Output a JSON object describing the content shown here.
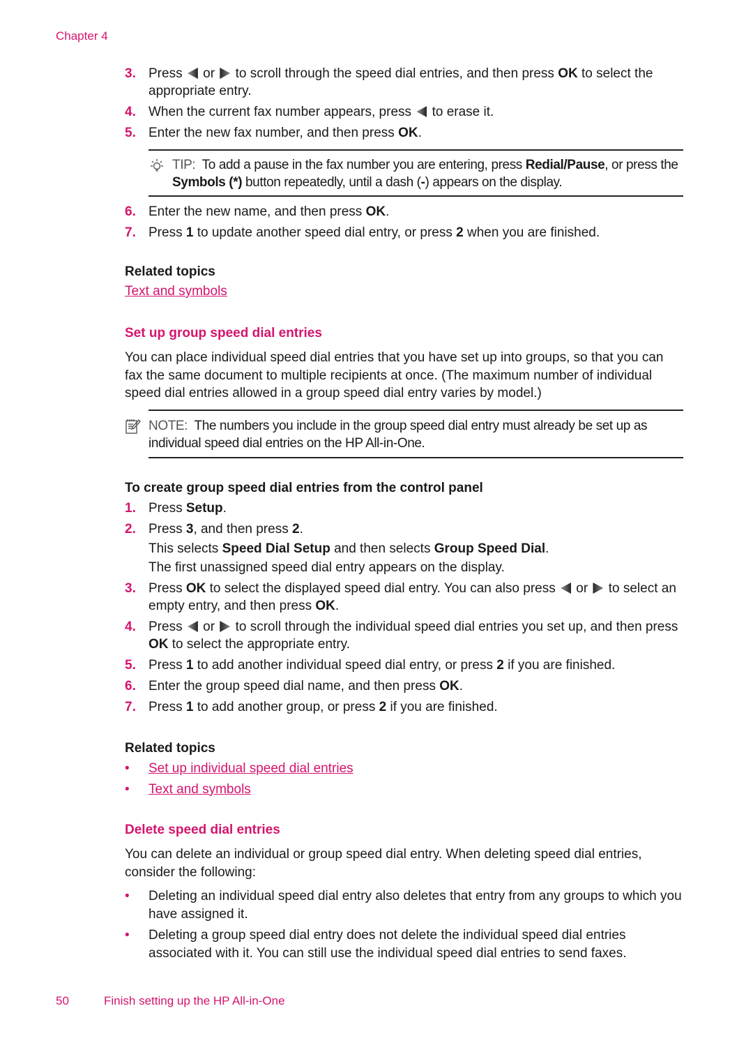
{
  "header": {
    "chapter": "Chapter 4"
  },
  "steps_top": [
    {
      "num": "3.",
      "parts": [
        "Press ",
        "{left}",
        " or ",
        "{right}",
        " to scroll through the speed dial entries, and then press ",
        "**OK",
        " to select the appropriate entry."
      ]
    },
    {
      "num": "4.",
      "parts": [
        "When the current fax number appears, press ",
        "{left}",
        " to erase it."
      ]
    },
    {
      "num": "5.",
      "parts": [
        "Enter the new fax number, and then press ",
        "**OK",
        "."
      ]
    }
  ],
  "tip": {
    "icon": "lightbulb-icon",
    "label": "TIP:",
    "parts": [
      "To add a pause in the fax number you are entering, press ",
      "**Redial/Pause",
      ", or press the ",
      "**Symbols (*)",
      " button repeatedly, until a dash (",
      "**-",
      ") appears on the display."
    ]
  },
  "steps_top2": [
    {
      "num": "6.",
      "parts": [
        "Enter the new name, and then press ",
        "**OK",
        "."
      ]
    },
    {
      "num": "7.",
      "parts": [
        "Press ",
        "**1",
        " to update another speed dial entry, or press ",
        "**2",
        " when you are finished."
      ]
    }
  ],
  "related1": {
    "heading": "Related topics",
    "links": [
      "Text and symbols"
    ]
  },
  "section_group": {
    "heading": "Set up group speed dial entries",
    "intro": "You can place individual speed dial entries that you have set up into groups, so that you can fax the same document to multiple recipients at once. (The maximum number of individual speed dial entries allowed in a group speed dial entry varies by model.)",
    "note": {
      "icon": "note-icon",
      "label": "NOTE:",
      "text": "The numbers you include in the group speed dial entry must already be set up as individual speed dial entries on the HP All-in-One."
    },
    "procedure_heading": "To create group speed dial entries from the control panel",
    "steps": [
      {
        "num": "1.",
        "parts": [
          "Press ",
          "**Setup",
          "."
        ]
      },
      {
        "num": "2.",
        "parts": [
          "Press ",
          "**3",
          ", and then press ",
          "**2",
          "."
        ],
        "extra": [
          [
            "This selects ",
            "**Speed Dial Setup",
            " and then selects ",
            "**Group Speed Dial",
            "."
          ],
          [
            "The first unassigned speed dial entry appears on the display."
          ]
        ]
      },
      {
        "num": "3.",
        "parts": [
          "Press ",
          "**OK",
          " to select the displayed speed dial entry. You can also press ",
          "{left}",
          " or ",
          "{right}",
          " to select an empty entry, and then press ",
          "**OK",
          "."
        ]
      },
      {
        "num": "4.",
        "parts": [
          "Press ",
          "{left}",
          " or ",
          "{right}",
          " to scroll through the individual speed dial entries you set up, and then press ",
          "**OK",
          " to select the appropriate entry."
        ]
      },
      {
        "num": "5.",
        "parts": [
          "Press ",
          "**1",
          " to add another individual speed dial entry, or press ",
          "**2",
          " if you are finished."
        ]
      },
      {
        "num": "6.",
        "parts": [
          "Enter the group speed dial name, and then press ",
          "**OK",
          "."
        ]
      },
      {
        "num": "7.",
        "parts": [
          "Press ",
          "**1",
          " to add another group, or press ",
          "**2",
          " if you are finished."
        ]
      }
    ]
  },
  "related2": {
    "heading": "Related topics",
    "bullet": "•",
    "links": [
      "Set up individual speed dial entries",
      "Text and symbols"
    ]
  },
  "section_delete": {
    "heading": "Delete speed dial entries",
    "intro": "You can delete an individual or group speed dial entry. When deleting speed dial entries, consider the following:",
    "bullet": "•",
    "bullets": [
      "Deleting an individual speed dial entry also deletes that entry from any groups to which you have assigned it.",
      "Deleting a group speed dial entry does not delete the individual speed dial entries associated with it. You can still use the individual speed dial entries to send faxes."
    ]
  },
  "footer": {
    "page_number": "50",
    "title": "Finish setting up the HP All-in-One"
  },
  "colors": {
    "accent": "#d4146e",
    "text": "#1a1a1a",
    "rule": "#222222"
  }
}
